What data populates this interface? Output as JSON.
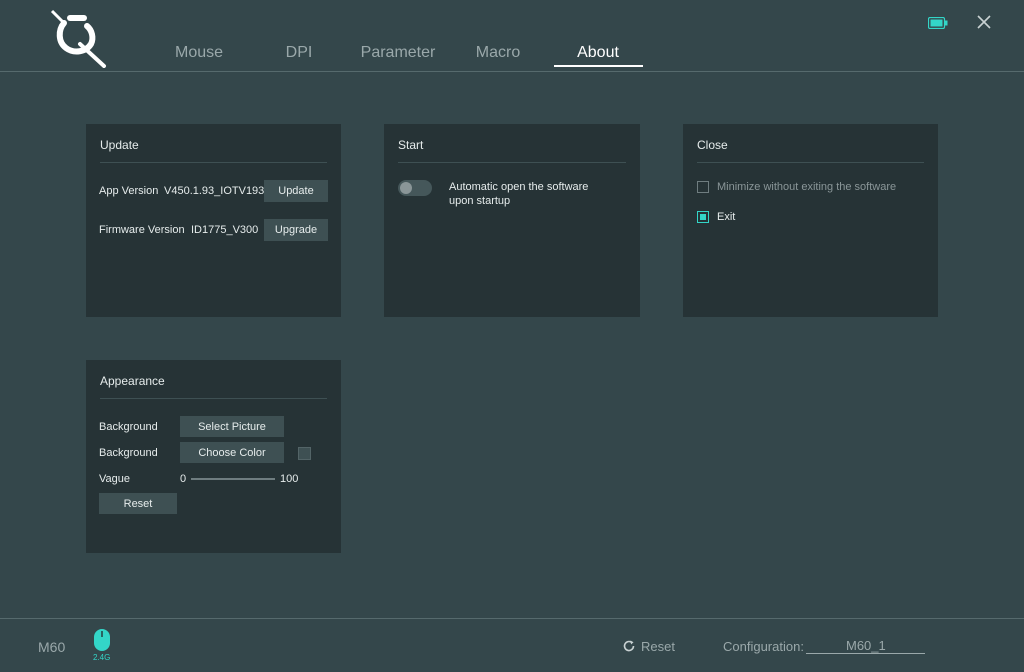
{
  "nav": {
    "tabs": [
      {
        "label": "Mouse"
      },
      {
        "label": "DPI"
      },
      {
        "label": "Parameter"
      },
      {
        "label": "Macro"
      },
      {
        "label": "About"
      }
    ],
    "active": "About"
  },
  "header": {
    "battery_icon": "battery-icon",
    "close_icon": "close-icon"
  },
  "update_panel": {
    "title": "Update",
    "app_version_label": "App Version",
    "app_version_value": "V450.1.93_IOTV193",
    "update_button": "Update",
    "firmware_version_label": "Firmware Version",
    "firmware_version_value": "ID1775_V300",
    "upgrade_button": "Upgrade"
  },
  "start_panel": {
    "title": "Start",
    "auto_open_label_line1": "Automatic open the software",
    "auto_open_label_line2": "upon startup",
    "auto_open_enabled": false
  },
  "close_panel": {
    "title": "Close",
    "minimize_label": "Minimize without exiting the software",
    "minimize_checked": false,
    "exit_label": "Exit",
    "exit_checked": true
  },
  "appearance_panel": {
    "title": "Appearance",
    "background_picture_label": "Background",
    "select_picture_button": "Select Picture",
    "background_color_label": "Background",
    "choose_color_button": "Choose Color",
    "vague_label": "Vague",
    "vague_min": "0",
    "vague_max": "100",
    "reset_button": "Reset"
  },
  "footer": {
    "device_name": "M60",
    "connection": "2.4G",
    "reset_label": "Reset",
    "configuration_label": "Configuration:",
    "configuration_value": "M60_1"
  },
  "colors": {
    "background": "#34474b",
    "panel": "#263336",
    "accent": "#33d6c8",
    "button": "#3e5053"
  }
}
